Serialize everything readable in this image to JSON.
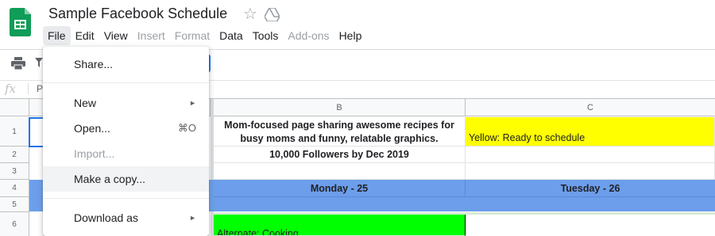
{
  "app": {
    "doc_title": "Sample Facebook Schedule",
    "icons": {
      "logo": "google-sheets-logo",
      "star": "star-icon",
      "drive": "move-to-drive-icon"
    }
  },
  "menubar": {
    "items": [
      {
        "label": "File",
        "state": "active"
      },
      {
        "label": "Edit",
        "state": "enabled"
      },
      {
        "label": "View",
        "state": "enabled"
      },
      {
        "label": "Insert",
        "state": "disabled"
      },
      {
        "label": "Format",
        "state": "disabled"
      },
      {
        "label": "Data",
        "state": "enabled"
      },
      {
        "label": "Tools",
        "state": "enabled"
      },
      {
        "label": "Add-ons",
        "state": "disabled"
      },
      {
        "label": "Help",
        "state": "enabled"
      }
    ]
  },
  "formula_bar": {
    "fx": "fx",
    "cell_ref": "P"
  },
  "file_menu": {
    "items": [
      {
        "label": "Share...",
        "state": "enabled"
      },
      {
        "label": "New",
        "state": "enabled",
        "submenu": true
      },
      {
        "label": "Open...",
        "state": "enabled",
        "shortcut": "⌘O"
      },
      {
        "label": "Import...",
        "state": "disabled"
      },
      {
        "label": "Make a copy...",
        "state": "hover"
      },
      {
        "label": "Download as",
        "state": "enabled",
        "submenu": true
      }
    ],
    "submenu_arrow": "►"
  },
  "grid": {
    "columns": [
      "B",
      "C"
    ],
    "rows": [
      "1",
      "2",
      "3",
      "4",
      "5",
      "6"
    ],
    "cells": {
      "B1": "Mom-focused page sharing awesome recipes for busy moms and funny, relatable graphics.",
      "C1": "Yellow: Ready to schedule",
      "B2": "10,000 Followers by Dec 2019",
      "B4": "Monday - 25",
      "C4": "Tuesday - 26",
      "B6": "Alternate: Cooking"
    }
  },
  "colors": {
    "yellow_fill": "#ffff00",
    "blue_fill": "#6d9eeb",
    "green_fill": "#00ff00",
    "selection": "#1a73e8",
    "sheets_green": "#0f9d58"
  }
}
